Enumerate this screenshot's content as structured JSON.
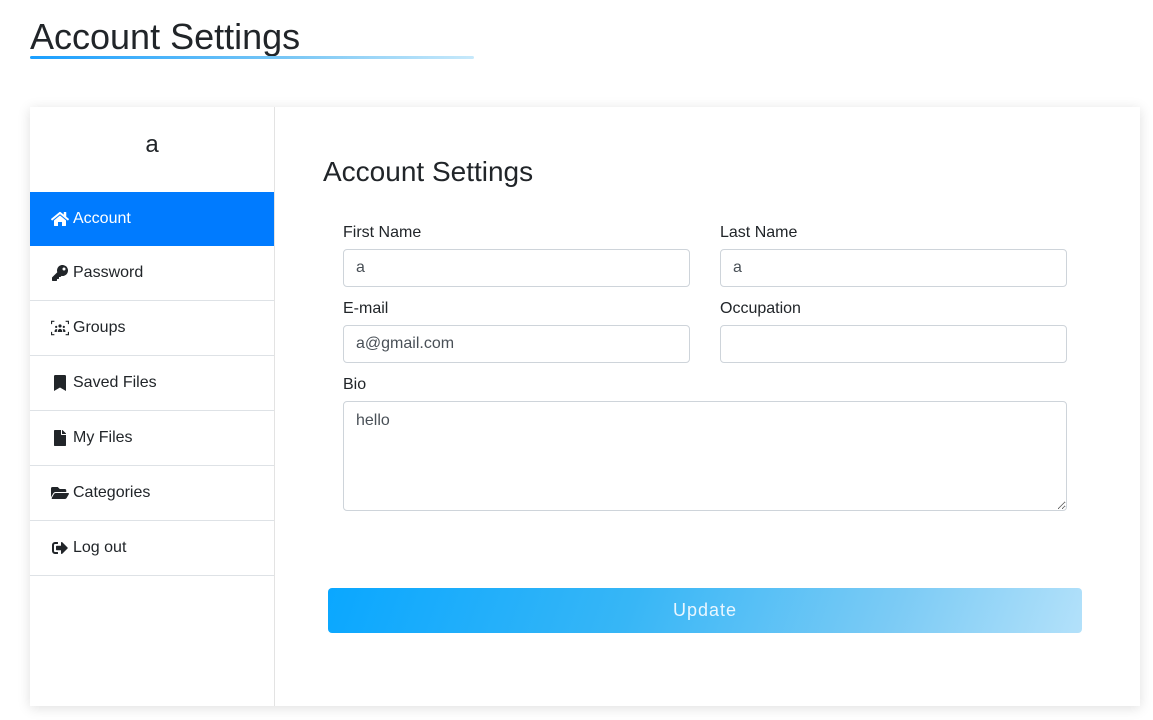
{
  "header": {
    "title": "Account Settings"
  },
  "sidebar": {
    "user_name": "a",
    "items": [
      {
        "label": "Account",
        "icon": "home-icon",
        "active": true
      },
      {
        "label": "Password",
        "icon": "key-icon"
      },
      {
        "label": "Groups",
        "icon": "users-icon"
      },
      {
        "label": "Saved Files",
        "icon": "bookmark-icon"
      },
      {
        "label": "My Files",
        "icon": "file-icon"
      },
      {
        "label": "Categories",
        "icon": "folder-open-icon"
      },
      {
        "label": "Log out",
        "icon": "sign-out-icon"
      }
    ]
  },
  "main": {
    "title": "Account Settings",
    "fields": {
      "first_name": {
        "label": "First Name",
        "value": "a"
      },
      "last_name": {
        "label": "Last Name",
        "value": "a"
      },
      "email": {
        "label": "E-mail",
        "value": "a@gmail.com"
      },
      "occupation": {
        "label": "Occupation",
        "value": ""
      },
      "bio": {
        "label": "Bio",
        "value": "hello"
      }
    },
    "update_label": "Update"
  },
  "colors": {
    "accent": "#007bff",
    "button_gradient_start": "#0aa7ff",
    "button_gradient_end": "#b3e1fa"
  }
}
